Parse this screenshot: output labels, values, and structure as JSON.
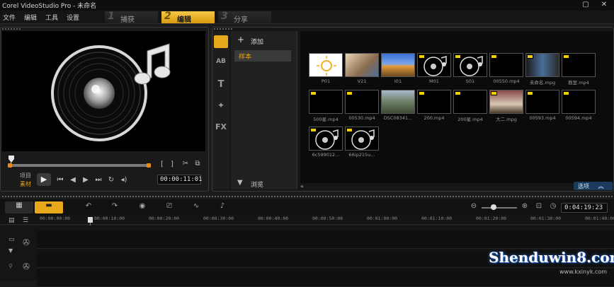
{
  "window": {
    "title": "Corel VideoStudio Pro - 未命名",
    "controls": [
      "▢",
      "✕"
    ]
  },
  "menu": [
    "文件",
    "编辑",
    "工具",
    "设置"
  ],
  "steps": [
    {
      "num": "1",
      "label": "捕获"
    },
    {
      "num": "2",
      "label": "编辑"
    },
    {
      "num": "3",
      "label": "分享"
    }
  ],
  "preview": {
    "mode_project": "项目",
    "mode_clip": "素材",
    "timecode": "00:00:11:01",
    "mark_in": "[",
    "mark_out": "]"
  },
  "library": {
    "add_label": "添加",
    "folder_selected": "样本",
    "browse_label": "浏览",
    "side_icons": [
      "AB",
      "T",
      "FX"
    ],
    "media_tab_icons": [
      "video-filter-icon",
      "photo-filter-icon",
      "audio-filter-icon"
    ],
    "thumbs": [
      {
        "label": "P01",
        "kind": "sun"
      },
      {
        "label": "V21",
        "kind": "kid"
      },
      {
        "label": "I01",
        "kind": "landscape"
      },
      {
        "label": "M01",
        "kind": "disc"
      },
      {
        "label": "S01",
        "kind": "disc"
      },
      {
        "label": "00550.mp4",
        "kind": "video-dark"
      },
      {
        "label": "未命名.mpg",
        "kind": "video-street"
      },
      {
        "label": "教室.mp4",
        "kind": "video-dark"
      },
      {
        "label": "500星.mp4",
        "kind": "video-dark"
      },
      {
        "label": "00530.mp4",
        "kind": "video-dark"
      },
      {
        "label": "DSC08341...",
        "kind": "landscape2"
      },
      {
        "label": "200.mp4",
        "kind": "video-dark"
      },
      {
        "label": "200星.mp4",
        "kind": "video-dark"
      },
      {
        "label": "大二.mpg",
        "kind": "video-scene"
      },
      {
        "label": "00593.mp4",
        "kind": "video-dark"
      },
      {
        "label": "00594.mp4",
        "kind": "video-dark"
      },
      {
        "label": "6c599012...",
        "kind": "disc"
      },
      {
        "label": "66ip215u...",
        "kind": "disc"
      }
    ],
    "options_label": "选项"
  },
  "timeline": {
    "timecode": "0:04:19:23",
    "ruler": [
      "00:00:00:00",
      "00:00:10:00",
      "00:00:20:00",
      "00:00:30:00",
      "00:00:40:00",
      "00:00:50:00",
      "00:01:00:00",
      "00:01:10:00",
      "00:01:20:00",
      "00:01:30:00",
      "00:01:40:00"
    ]
  },
  "watermark": {
    "main": "Shenduwin8.com",
    "sub": "www.kxinyk.com"
  },
  "colors": {
    "accent": "#e8a81b",
    "panel": "#0f0f0f",
    "options_bg": "#1a3b5c"
  }
}
